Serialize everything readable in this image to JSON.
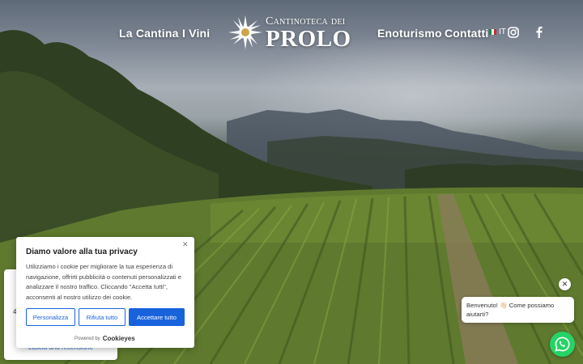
{
  "nav": {
    "left_items": [
      "La Cantina",
      "I Vini"
    ],
    "right_items": [
      "Enoturismo",
      "Contatti"
    ]
  },
  "logo": {
    "line1": "Cantinoteca dei",
    "line2": "PROLO"
  },
  "language": {
    "code": "IT",
    "flag_colors": [
      "#009246",
      "#ffffff",
      "#ce2b37"
    ]
  },
  "social": [
    "instagram-icon",
    "facebook-icon"
  ],
  "review_widget": {
    "score": "4",
    "link_text": "Lascia una recensione"
  },
  "cookie_banner": {
    "title": "Diamo valore alla tua privacy",
    "body": "Utilizziamo i cookie per migliorare la tua esperienza di navigazione, offrirti pubblicità o contenuti personalizzati e analizzare il nostro traffico. Cliccando \"Accetta tutti\", acconsenti al nostro utilizzo dei cookie.",
    "buttons": {
      "customize": "Personalizza",
      "reject": "Rifiuta tutto",
      "accept": "Accettare tutto"
    },
    "powered_prefix": "Powered by",
    "powered_brand": "Cookieyes",
    "accent_color": "#1863dc"
  },
  "chat": {
    "greeting": "Benvenuto! 👋🏻 Come possiamo aiutarti?",
    "button_color": "#25d366"
  }
}
